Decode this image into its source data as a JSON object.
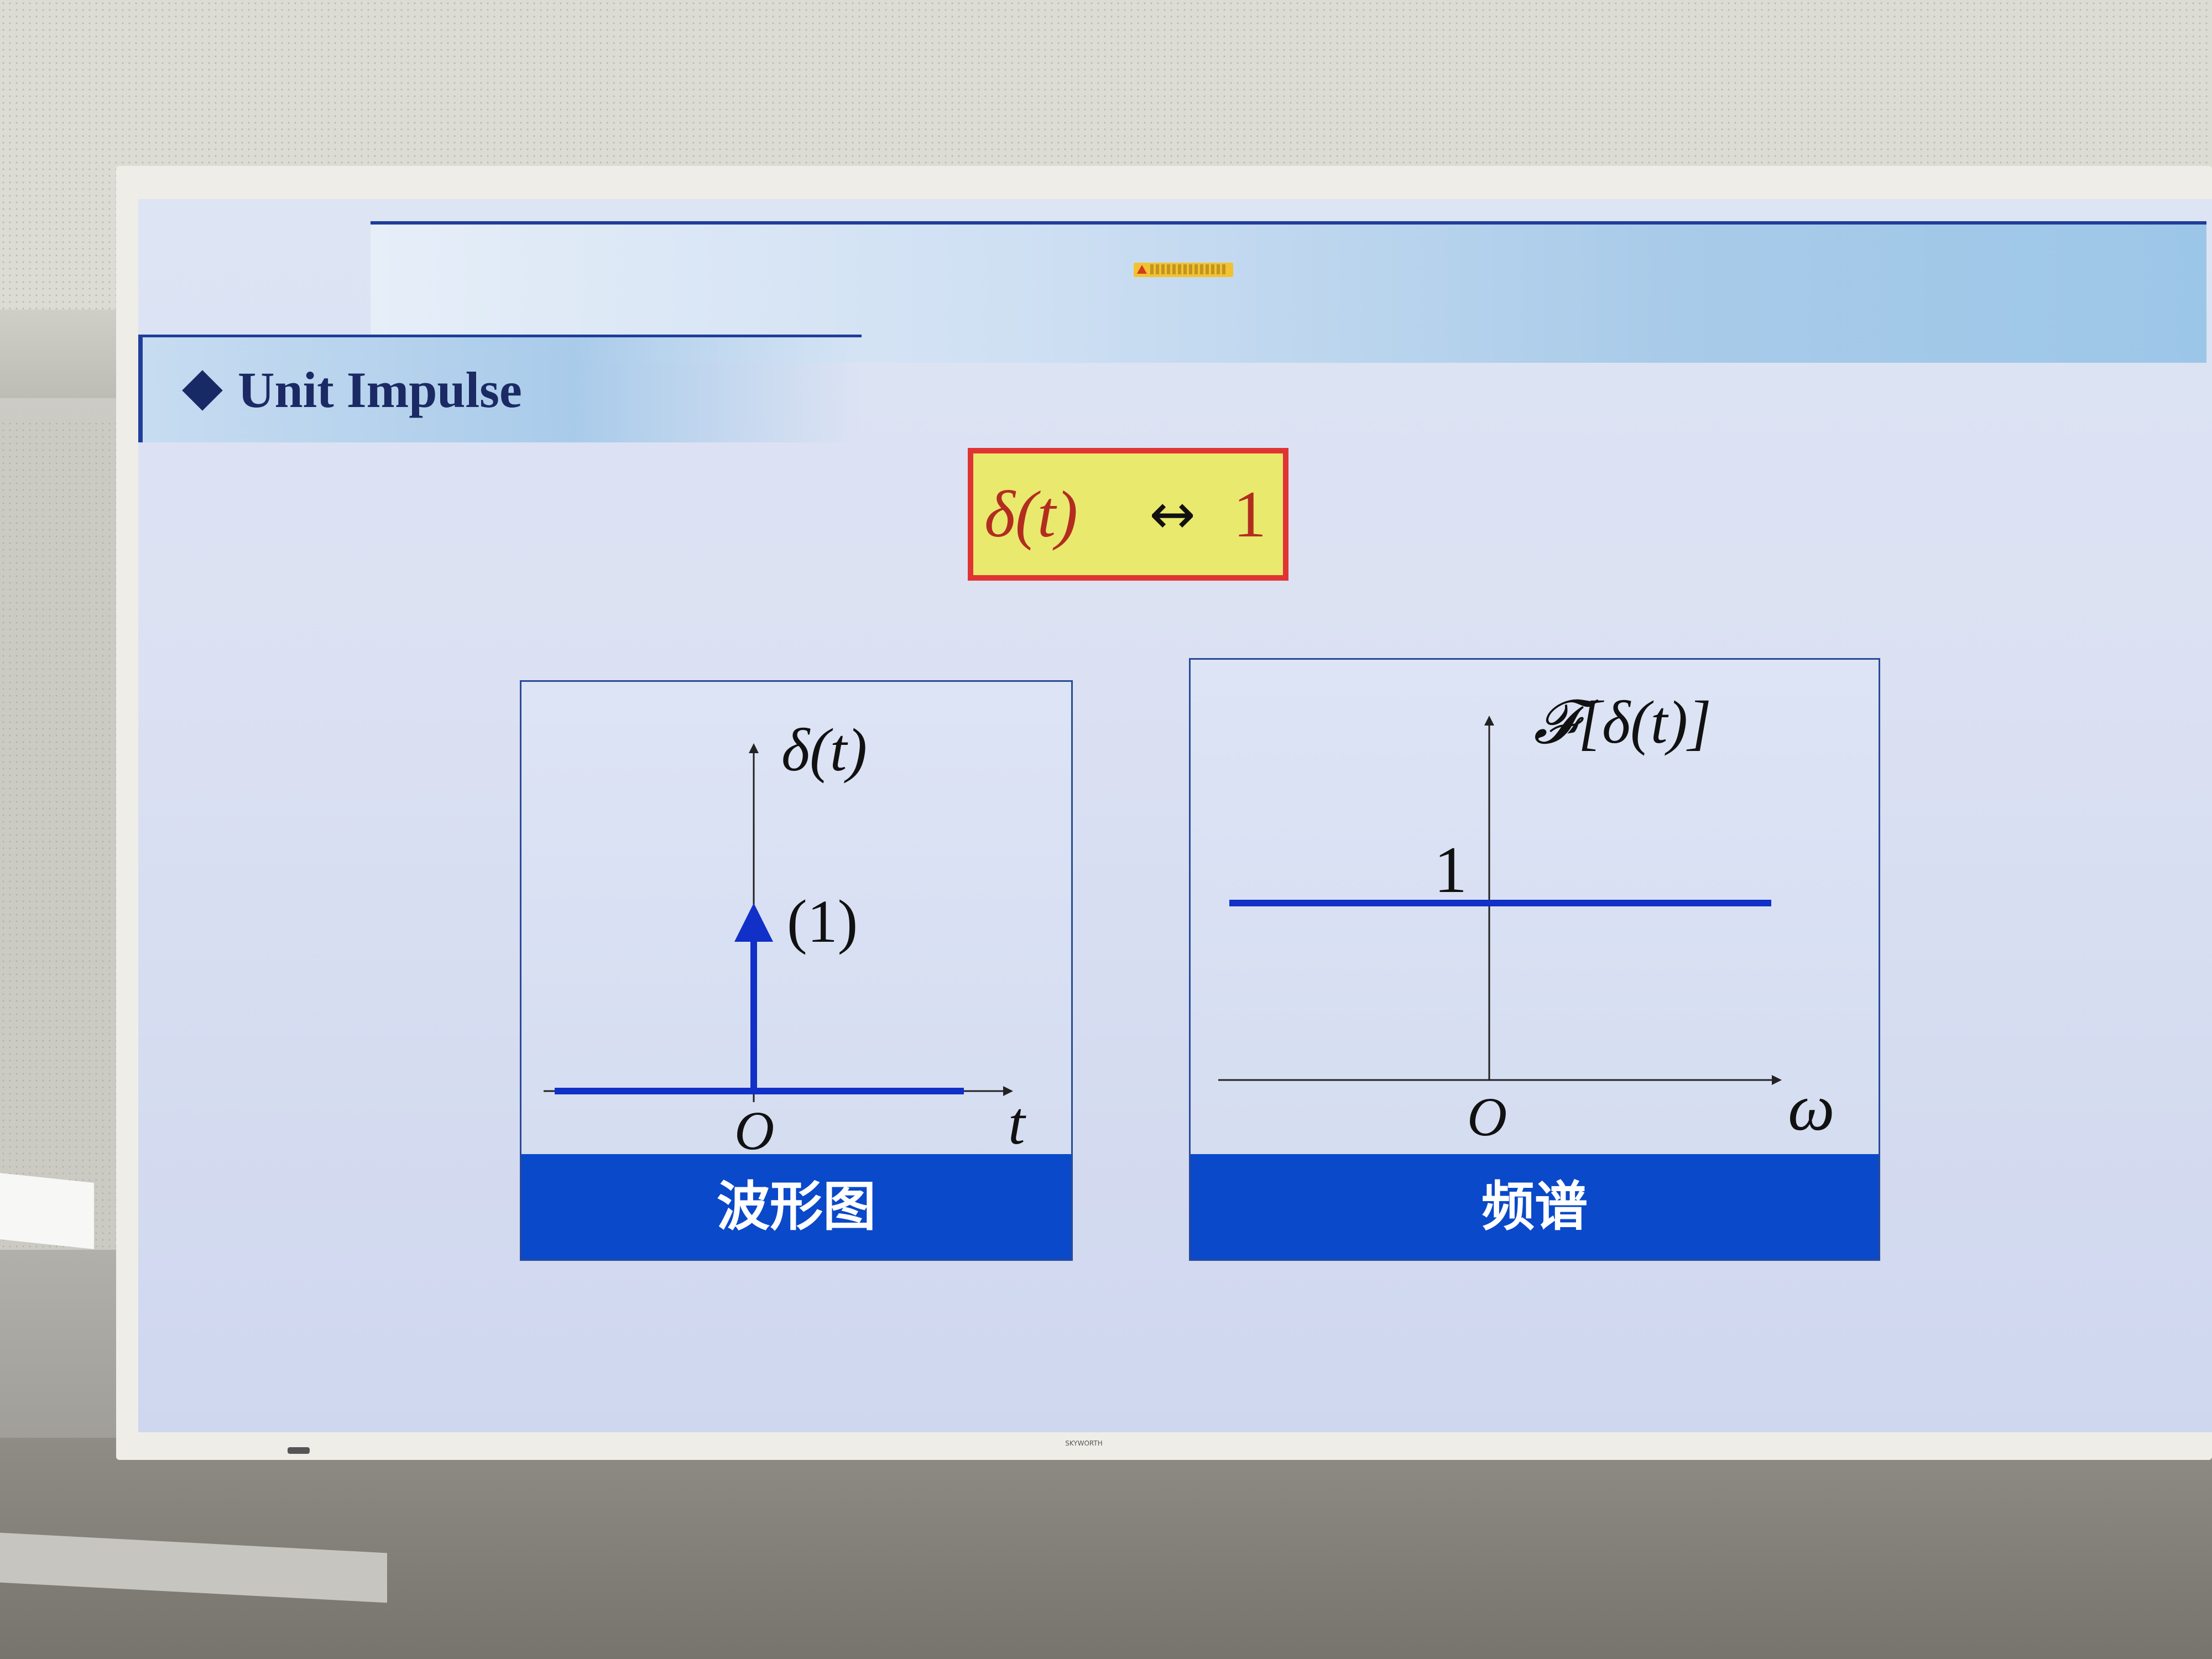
{
  "slide": {
    "title": "Unit Impulse",
    "formula": {
      "lhs": "δ(t)",
      "arrow": "↔",
      "rhs": "1"
    }
  },
  "left_panel": {
    "caption": "波形图",
    "y_label": "δ(t)",
    "impulse_label": "(1)",
    "origin_label": "O",
    "x_label": "t"
  },
  "right_panel": {
    "caption": "频谱",
    "y_label": "𝓕[δ(t)]",
    "level_label": "1",
    "origin_label": "O",
    "x_label": "ω"
  },
  "device": {
    "brand": "SKYWORTH"
  },
  "colors": {
    "title_band_line": "#1f3d99",
    "caption_bg": "#0a49c9",
    "formula_bg": "#e9e96e",
    "formula_border": "#e03434",
    "signal_line": "#1030c8"
  }
}
